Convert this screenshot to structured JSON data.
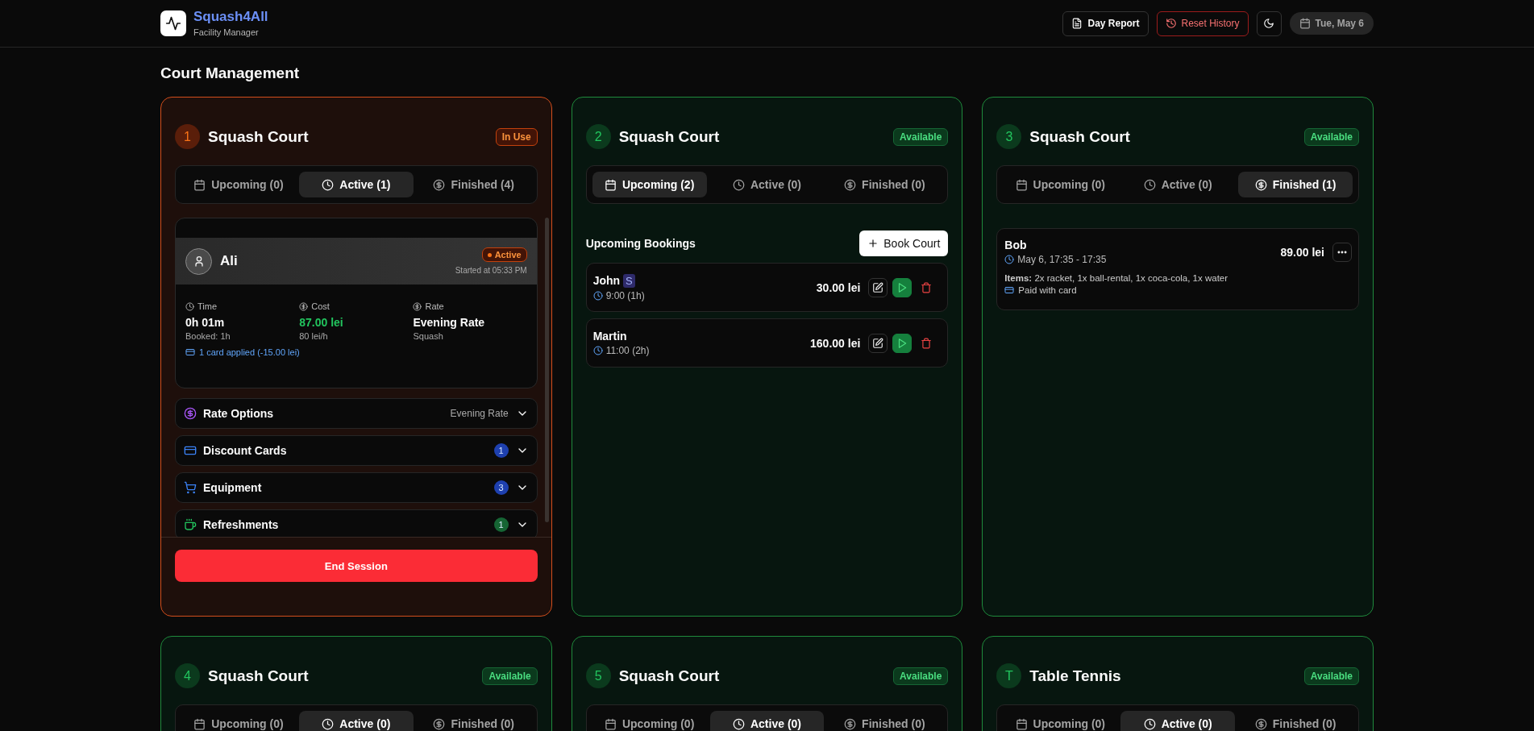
{
  "header": {
    "logo_title": "Squash4All",
    "logo_subtitle": "Facility Manager",
    "actions": [
      {
        "kind": "report",
        "label": "Day Report"
      },
      {
        "kind": "reset",
        "label": "Reset History"
      },
      {
        "kind": "theme"
      },
      {
        "kind": "date",
        "label": "Tue, May 6"
      }
    ]
  },
  "page_title": "Court Management",
  "courts": [
    {
      "number": "1",
      "title": "Squash Court",
      "status": {
        "kind": "in_use",
        "label": "In Use"
      },
      "tabs": [
        {
          "kind": "upcoming",
          "label": "Upcoming (0)",
          "selected": false
        },
        {
          "kind": "active",
          "label": "Active (1)",
          "selected": true
        },
        {
          "kind": "finished",
          "label": "Finished (4)",
          "selected": false
        }
      ],
      "kind": "active",
      "session": {
        "player": "Ali",
        "badge": "Active",
        "started": "Started at 05:33 PM",
        "stats": [
          {
            "kind": "time",
            "label": "Time",
            "value": "0h 01m",
            "note": "Booked: 1h",
            "highlight": false
          },
          {
            "kind": "cost",
            "label": "Cost",
            "value": "87.00 lei",
            "note": "80 lei/h",
            "highlight": true
          },
          {
            "kind": "rate",
            "label": "Rate",
            "value": "Evening Rate",
            "note": "Squash",
            "highlight": false
          }
        ],
        "discount_note": "1 card applied (-15.00 lei)"
      },
      "sections": [
        {
          "kind": "rate",
          "color": "#a855f7",
          "label": "Rate Options",
          "value": "Evening Rate"
        },
        {
          "kind": "cards",
          "color": "#3b82f6",
          "label": "Discount Cards",
          "count": {
            "label": "1",
            "color": "#1e40af"
          }
        },
        {
          "kind": "equipment",
          "color": "#3b82f6",
          "label": "Equipment",
          "count": {
            "label": "3",
            "color": "#1e40af"
          }
        },
        {
          "kind": "refreshments",
          "color": "#22c55e",
          "label": "Refreshments",
          "count": {
            "label": "1",
            "color": "#166534"
          }
        }
      ],
      "end_button": "End Session"
    },
    {
      "number": "2",
      "title": "Squash Court",
      "status": {
        "kind": "available",
        "label": "Available"
      },
      "tabs": [
        {
          "kind": "upcoming",
          "label": "Upcoming (2)",
          "selected": true
        },
        {
          "kind": "active",
          "label": "Active (0)",
          "selected": false
        },
        {
          "kind": "finished",
          "label": "Finished (0)",
          "selected": false
        }
      ],
      "kind": "upcoming",
      "list_title": "Upcoming Bookings",
      "add_button": "Book Court",
      "bookings": [
        {
          "name": "John",
          "tag": "S",
          "time": "9:00 (1h)",
          "price": "30.00 lei"
        },
        {
          "name": "Martin",
          "time": "11:00 (2h)",
          "price": "160.00 lei"
        }
      ]
    },
    {
      "number": "3",
      "title": "Squash Court",
      "status": {
        "kind": "available",
        "label": "Available"
      },
      "tabs": [
        {
          "kind": "upcoming",
          "label": "Upcoming (0)",
          "selected": false
        },
        {
          "kind": "active",
          "label": "Active (0)",
          "selected": false
        },
        {
          "kind": "finished",
          "label": "Finished (1)",
          "selected": true
        }
      ],
      "kind": "finished",
      "history": [
        {
          "name": "Bob",
          "time": "May 6, 17:35 - 17:35",
          "price": "89.00 lei",
          "items": "**Items:** 2x racket, 1x ball-rental, 1x coca-cola, 1x water",
          "payment": "Paid with card"
        }
      ]
    },
    {
      "number": "4",
      "title": "Squash Court",
      "status": {
        "kind": "available",
        "label": "Available"
      },
      "tabs": [
        {
          "kind": "upcoming",
          "label": "Upcoming (0)",
          "selected": false
        },
        {
          "kind": "active",
          "label": "Active (0)",
          "selected": true
        },
        {
          "kind": "finished",
          "label": "Finished (0)",
          "selected": false
        }
      ]
    },
    {
      "number": "5",
      "title": "Squash Court",
      "status": {
        "kind": "available",
        "label": "Available"
      },
      "tabs": [
        {
          "kind": "upcoming",
          "label": "Upcoming (0)",
          "selected": false
        },
        {
          "kind": "active",
          "label": "Active (0)",
          "selected": true
        },
        {
          "kind": "finished",
          "label": "Finished (0)",
          "selected": false
        }
      ]
    },
    {
      "number": "T",
      "title": "Table Tennis",
      "status": {
        "kind": "available",
        "label": "Available"
      },
      "tabs": [
        {
          "kind": "upcoming",
          "label": "Upcoming (0)",
          "selected": false
        },
        {
          "kind": "active",
          "label": "Active (0)",
          "selected": true
        },
        {
          "kind": "finished",
          "label": "Finished (0)",
          "selected": false
        }
      ]
    }
  ]
}
